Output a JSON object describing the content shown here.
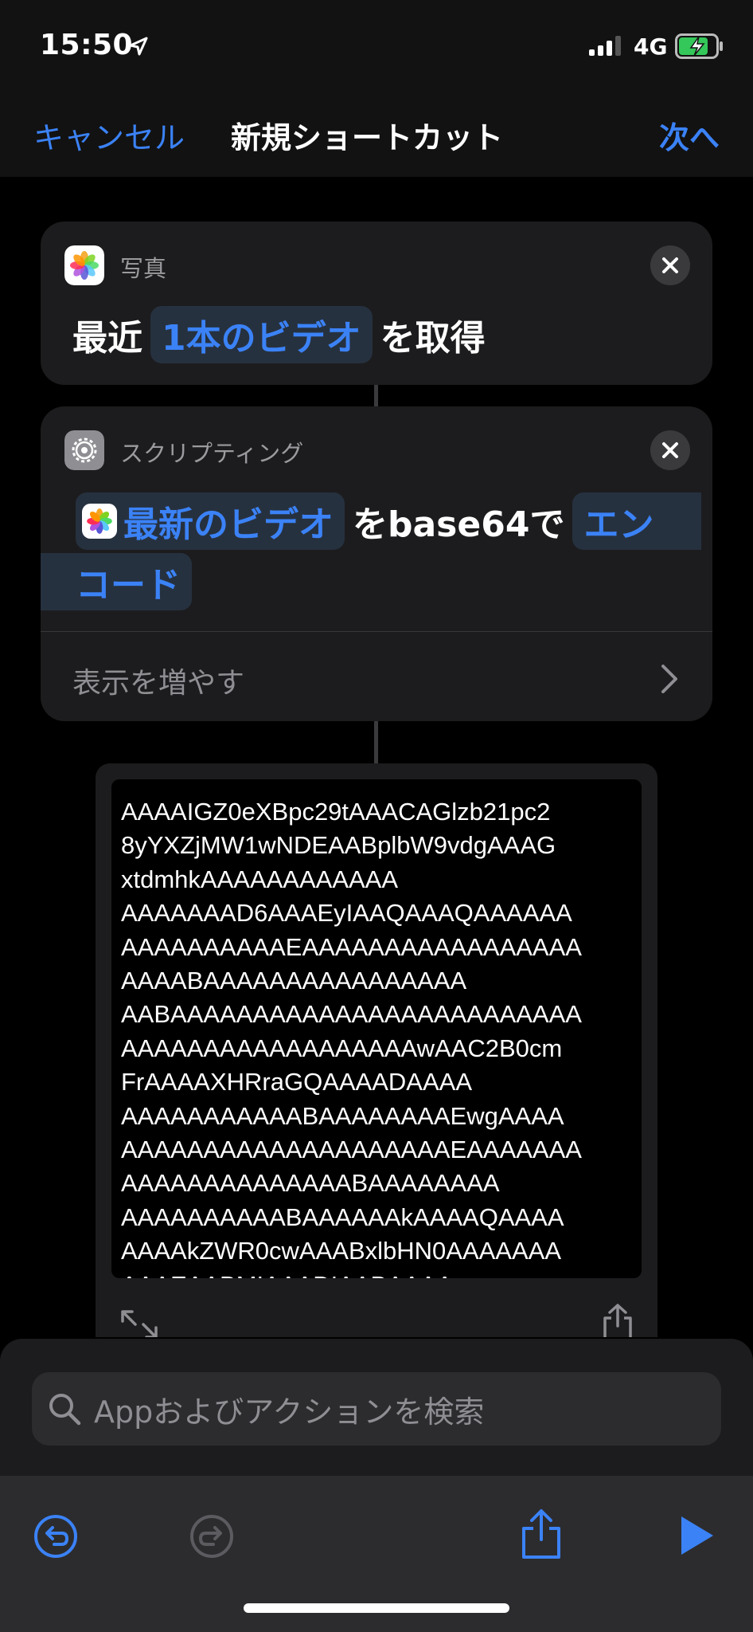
{
  "status_bar": {
    "time": "15:50",
    "network": "4G"
  },
  "nav": {
    "cancel": "キャンセル",
    "title": "新規ショートカット",
    "next": "次へ"
  },
  "action1": {
    "app_label": "写真",
    "prefix": "最近",
    "token": "1本のビデオ",
    "suffix": "を取得"
  },
  "action2": {
    "app_label": "スクリプティング",
    "input_token": "最新のビデオ",
    "middle": "をbase64で",
    "mode_token_part1": "エン",
    "mode_token_part2": "コード",
    "show_more": "表示を増やす"
  },
  "output": {
    "lines": [
      "AAAAIGZ0eXBpc29tAAACAGlzb21pc2",
      "8yYXZjMW1wNDEAABplbW9vdgAAAG",
      "xtdmhkAAAAAAAAAAAA",
      "AAAAAAAD6AAAEyIAAQAAAQAAAAAA",
      "AAAAAAAAAAEAAAAAAAAAAAAAAAAA",
      "AAAABAAAAAAAAAAAAAAAA",
      "AABAAAAAAAAAAAAAAAAAAAAAAAAA",
      "AAAAAAAAAAAAAAAAAAwAAC2B0cm",
      "FrAAAAXHRraGQAAAADAAAA",
      "AAAAAAAAAAABAAAAAAAAEwgAAAA",
      "AAAAAAAAAAAAAAAAAAAAEAAAAAAA",
      "AAAAAAAAAAAAAABAAAAAAAA",
      "AAAAAAAAAABAAAAAAkAAAAQAAAA",
      "AAAAkZWR0cwAAABxlbHN0AAAAAAA",
      "AAAEAABMIAAADIAABAAAA"
    ]
  },
  "search": {
    "placeholder": "Appおよびアクションを検索"
  },
  "colors": {
    "accent": "#3b82f6",
    "background": "#000000",
    "card": "#1c1c1e"
  },
  "icons": [
    "location-arrow-icon",
    "photos-icon",
    "gear-icon",
    "close-icon",
    "chevron-right-icon",
    "expand-icon",
    "share-icon",
    "search-icon",
    "undo-icon",
    "redo-icon",
    "play-icon"
  ]
}
